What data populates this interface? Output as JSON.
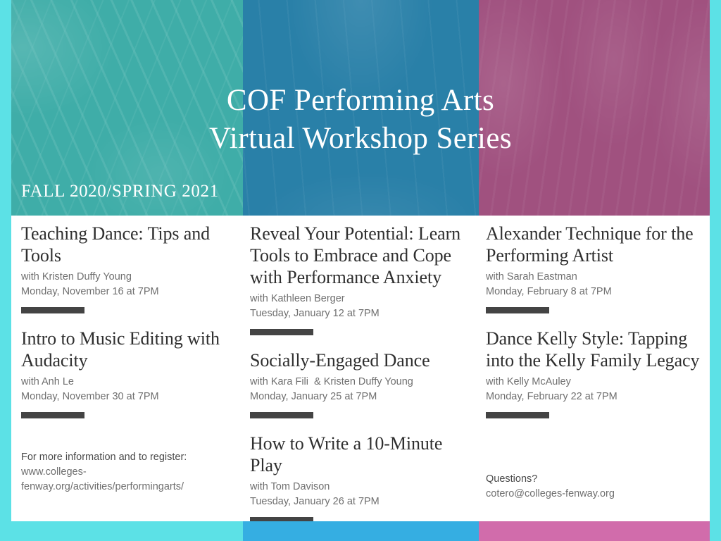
{
  "banner": {
    "title": "COF Performing Arts\nVirtual Workshop Series",
    "term": "FALL 2020/SPRING 2021",
    "panel_colors": {
      "teal": "#3fada8",
      "blue": "#2980a8",
      "plum": "#a0517f"
    }
  },
  "frame": {
    "side_color": "#5ce1e6",
    "bottom_segments": [
      "#5ce1e6",
      "#35aee2",
      "#d16cab"
    ]
  },
  "rule_color": "#444444",
  "columns": [
    {
      "id": "column-left",
      "sessions": [
        {
          "title": "Teaching Dance: Tips and Tools",
          "presenter": "with Kristen Duffy Young",
          "datetime": "Monday, November 16 at 7PM"
        },
        {
          "title": "Intro to Music Editing with Audacity",
          "presenter": "with Anh Le",
          "datetime": "Monday, November 30 at 7PM"
        }
      ],
      "footnote": {
        "head": "For more information and to register:",
        "body": "www.colleges-\nfenway.org/activities/performingarts/"
      }
    },
    {
      "id": "column-middle",
      "sessions": [
        {
          "title": "Reveal Your Potential: Learn Tools to Embrace and Cope with Performance Anxiety",
          "presenter": "with Kathleen Berger",
          "datetime": "Tuesday, January 12 at 7PM"
        },
        {
          "title": "Socially-Engaged Dance",
          "presenter": "with Kara Fili  & Kristen Duffy Young",
          "datetime": "Monday, January 25 at 7PM"
        },
        {
          "title": "How to Write a 10-Minute Play",
          "presenter": "with Tom Davison",
          "datetime": "Tuesday, January 26 at 7PM"
        }
      ],
      "footnote": null
    },
    {
      "id": "column-right",
      "sessions": [
        {
          "title": "Alexander Technique for the Performing Artist",
          "presenter": "with Sarah Eastman",
          "datetime": "Monday, February 8 at 7PM"
        },
        {
          "title": "Dance Kelly Style: Tapping into the Kelly Family Legacy",
          "presenter": "with Kelly McAuley",
          "datetime": "Monday, February 22 at 7PM"
        }
      ],
      "footnote": {
        "head": "Questions?",
        "body": "cotero@colleges-fenway.org"
      }
    }
  ]
}
